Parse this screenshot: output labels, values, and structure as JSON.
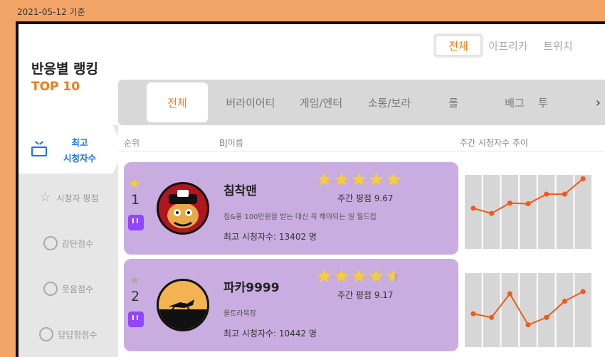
{
  "date_label": "2021-05-12 기준",
  "title": "반응별 랭킹",
  "subtitle": "TOP 10",
  "platform_tabs": [
    "전체",
    "아프리카",
    "트위치"
  ],
  "category_tabs": [
    "전체",
    "버라이어티",
    "게임/엔터",
    "소통/보라",
    "롤",
    "배그",
    "투"
  ],
  "category_next": "›",
  "sidebar": {
    "active_label_line1": "최고",
    "active_label_line2": "시청자수",
    "items": [
      "시청자 평점",
      "감탄점수",
      "웃음점수",
      "답답함점수"
    ]
  },
  "columns": {
    "rank": "순위",
    "bj_name": "BJ이름",
    "trend": "주간 시청자수 추이"
  },
  "colors": {
    "accent": "#f07b1c",
    "card": "#c9ade0",
    "line": "#f05a14",
    "twitch": "#9146ff"
  },
  "rows": [
    {
      "rank": "1",
      "name": "침착맨",
      "stars": 5,
      "rating": "주간 평점 9.67",
      "desc": "침&풍 100만원을 받는 대신 꼭 해야되는 일 월드컵",
      "viewers": "최고 시청자수: 13402 명",
      "badge_icon": "twitch-icon",
      "trend": [
        0.55,
        0.48,
        0.62,
        0.61,
        0.74,
        0.74,
        0.95
      ]
    },
    {
      "rank": "2",
      "name": "파카9999",
      "stars": 4.5,
      "rating": "주간 평점 9.17",
      "desc": "울트라목장",
      "viewers": "최고 시청자수: 10442 명",
      "badge_icon": "twitch-icon",
      "trend": [
        0.45,
        0.4,
        0.72,
        0.3,
        0.4,
        0.62,
        0.75
      ]
    }
  ]
}
